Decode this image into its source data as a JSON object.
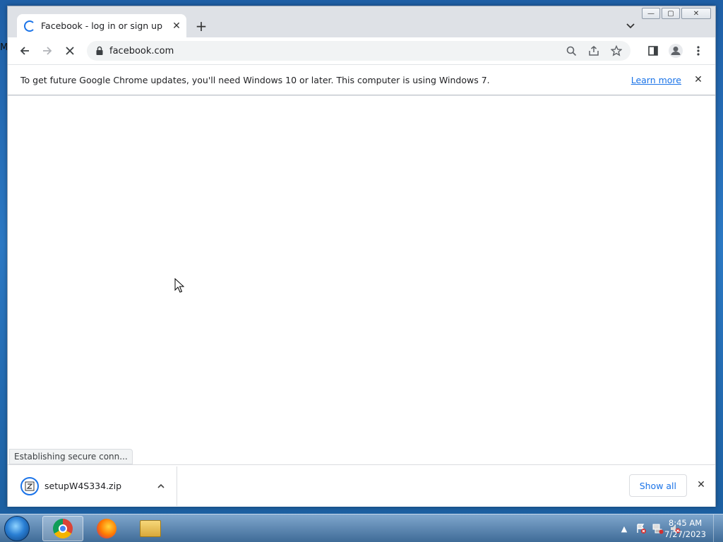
{
  "desktop": {
    "edge_char": "M"
  },
  "browser": {
    "tab": {
      "title": "Facebook - log in or sign up",
      "close": "✕"
    },
    "new_tab": "+",
    "address": {
      "url": "facebook.com"
    },
    "caption": {
      "minimize": "—",
      "restore": "▢",
      "close": "✕"
    },
    "infobar": {
      "message": "To get future Google Chrome updates, you'll need Windows 10 or later. This computer is using Windows 7.",
      "link": "Learn more",
      "close": "✕"
    },
    "status": "Establishing secure conn...",
    "download": {
      "filename": "setupW4S334.zip",
      "chevron": "⌃",
      "show_all": "Show all",
      "close": "✕"
    }
  },
  "taskbar": {
    "apps": [
      "chrome",
      "firefox",
      "file-explorer"
    ],
    "clock": {
      "time": "8:45 AM",
      "date": "7/27/2023"
    },
    "tray_arrow": "▲"
  }
}
